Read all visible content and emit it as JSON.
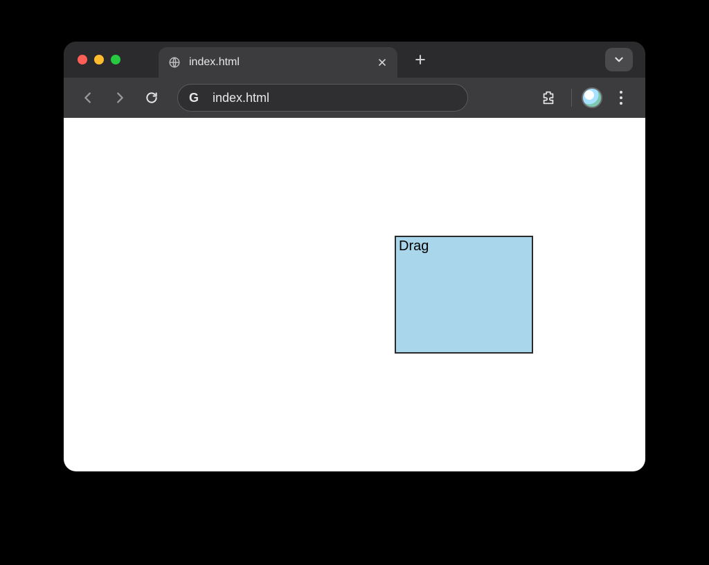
{
  "tab": {
    "title": "index.html"
  },
  "addressbar": {
    "url": "index.html"
  },
  "page": {
    "drag_box_label": "Drag"
  }
}
